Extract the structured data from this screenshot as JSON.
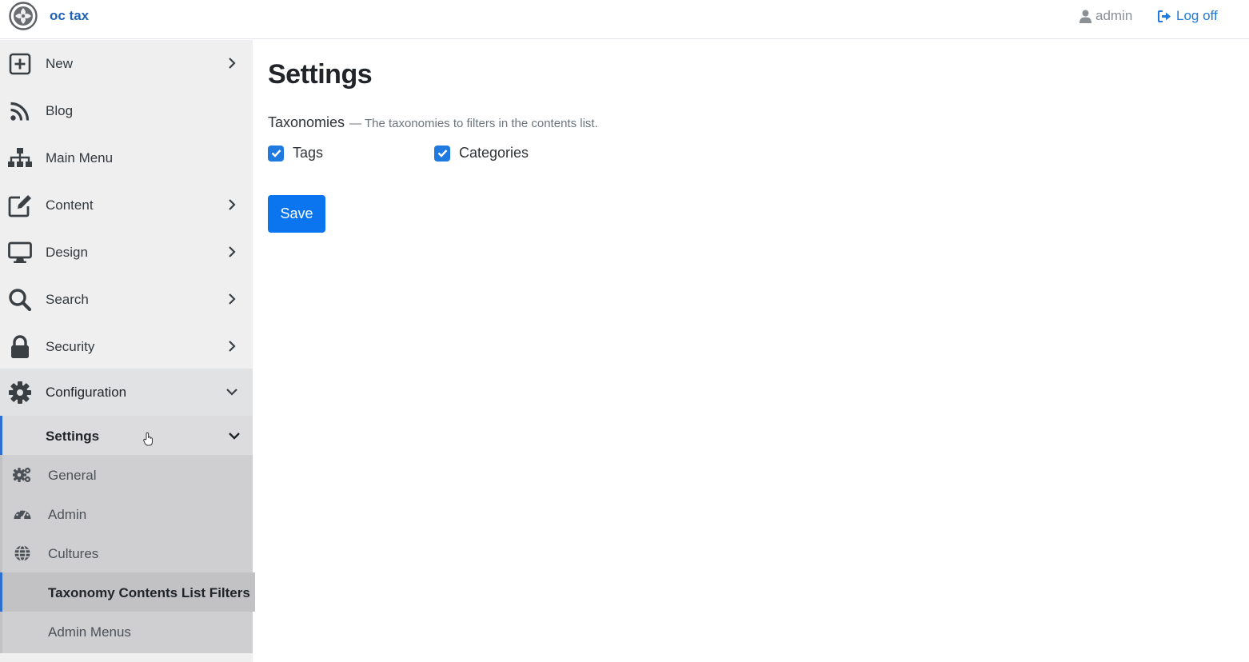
{
  "header": {
    "brand": "oc tax",
    "user": "admin",
    "logoff": "Log off"
  },
  "sidebar": {
    "items": [
      {
        "label": "New",
        "icon": "plus-square-icon"
      },
      {
        "label": "Blog",
        "icon": "rss-icon"
      },
      {
        "label": "Main Menu",
        "icon": "sitemap-icon"
      },
      {
        "label": "Content",
        "icon": "edit-icon"
      },
      {
        "label": "Design",
        "icon": "desktop-icon"
      },
      {
        "label": "Search",
        "icon": "search-icon"
      },
      {
        "label": "Security",
        "icon": "lock-icon"
      },
      {
        "label": "Configuration",
        "icon": "gear-icon"
      }
    ],
    "settings": {
      "label": "Settings"
    },
    "settings_children": [
      {
        "label": "General",
        "icon": "gears-icon"
      },
      {
        "label": "Admin",
        "icon": "dashboard-icon"
      },
      {
        "label": "Cultures",
        "icon": "globe-icon"
      },
      {
        "label": "Taxonomy Contents List Filters"
      },
      {
        "label": "Admin Menus"
      }
    ]
  },
  "main": {
    "title": "Settings",
    "field_label": "Taxonomies",
    "field_hint": "— The taxonomies to filters in the contents list.",
    "options": [
      {
        "label": "Tags",
        "checked": true
      },
      {
        "label": "Categories",
        "checked": true
      }
    ],
    "save_label": "Save"
  },
  "colors": {
    "accent": "#1f7ae0",
    "button": "#0b75f0",
    "sidebar_bg": "#efeff0",
    "active_border": "#2d6fcf"
  }
}
